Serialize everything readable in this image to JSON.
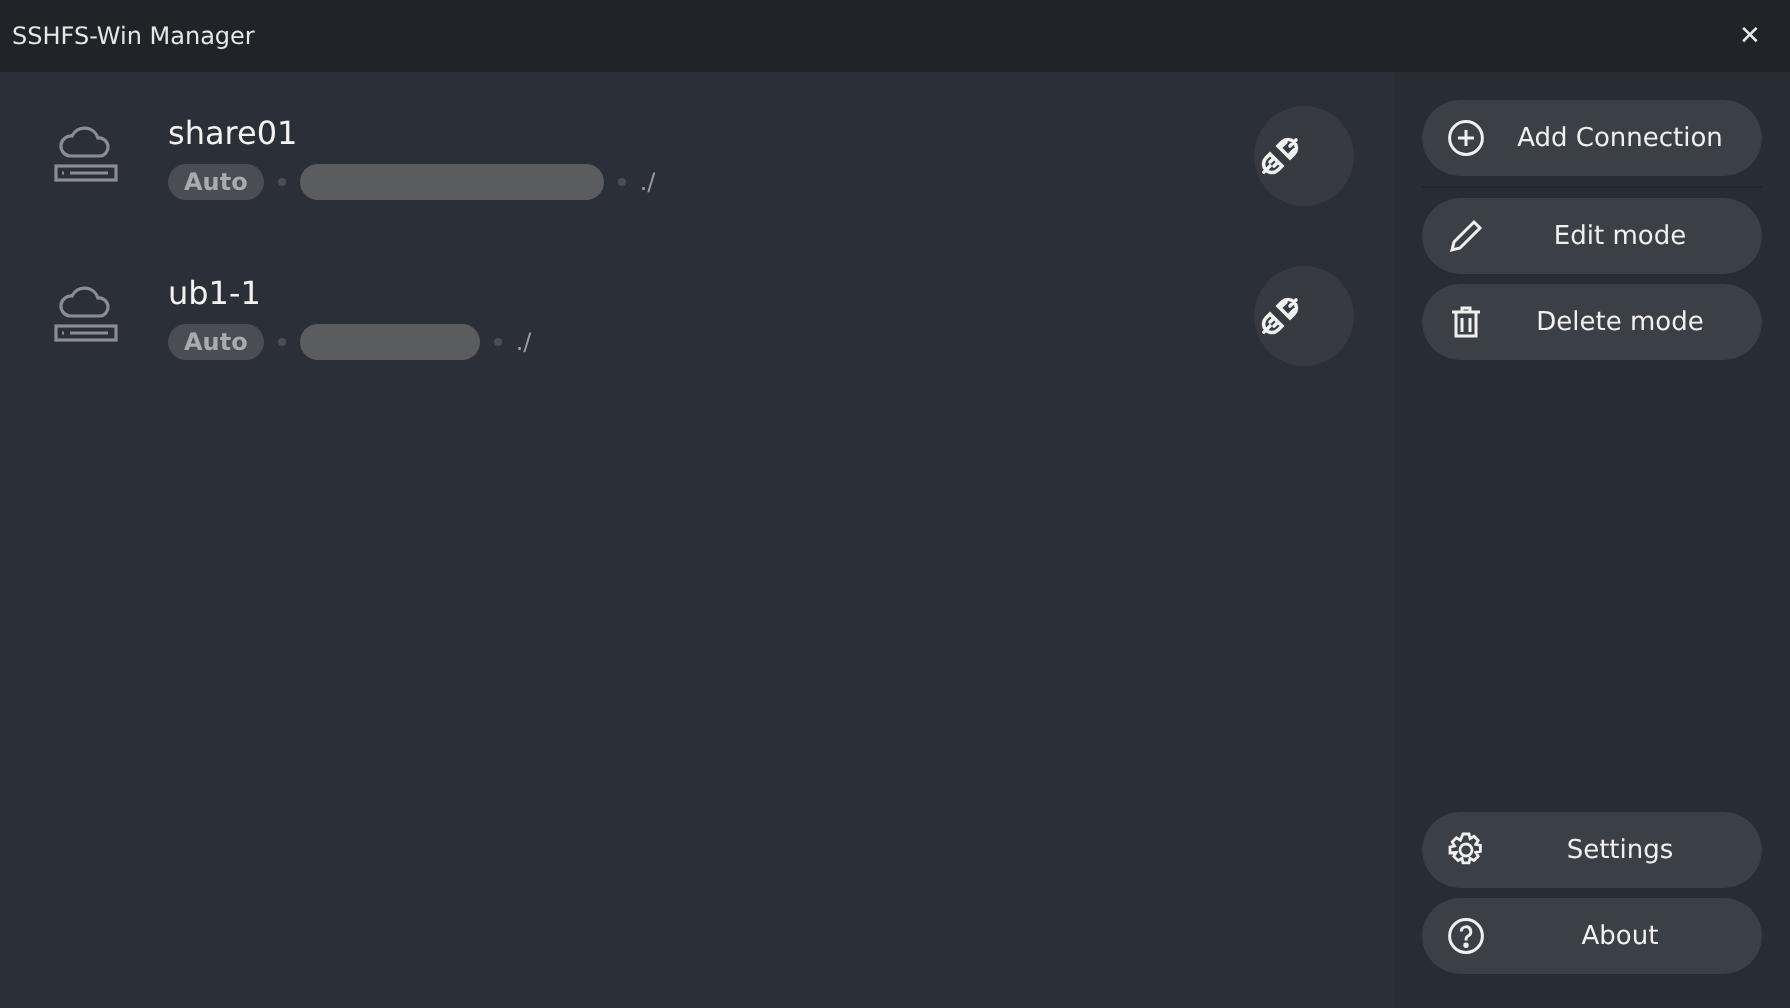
{
  "window": {
    "title": "SSHFS-Win Manager",
    "close": "✕"
  },
  "connections": [
    {
      "name": "share01",
      "mode": "Auto",
      "host_hidden": true,
      "path": "./"
    },
    {
      "name": "ub1-1",
      "mode": "Auto",
      "host_hidden": true,
      "path": "./"
    }
  ],
  "actions": [
    {
      "kind": "add",
      "label": "Add Connection",
      "divider_after": true
    },
    {
      "kind": "edit",
      "label": "Edit mode",
      "divider_after": false
    },
    {
      "kind": "delete",
      "label": "Delete mode",
      "divider_after": false
    }
  ],
  "footer_actions": [
    {
      "kind": "settings",
      "label": "Settings"
    },
    {
      "kind": "about",
      "label": "About"
    }
  ]
}
